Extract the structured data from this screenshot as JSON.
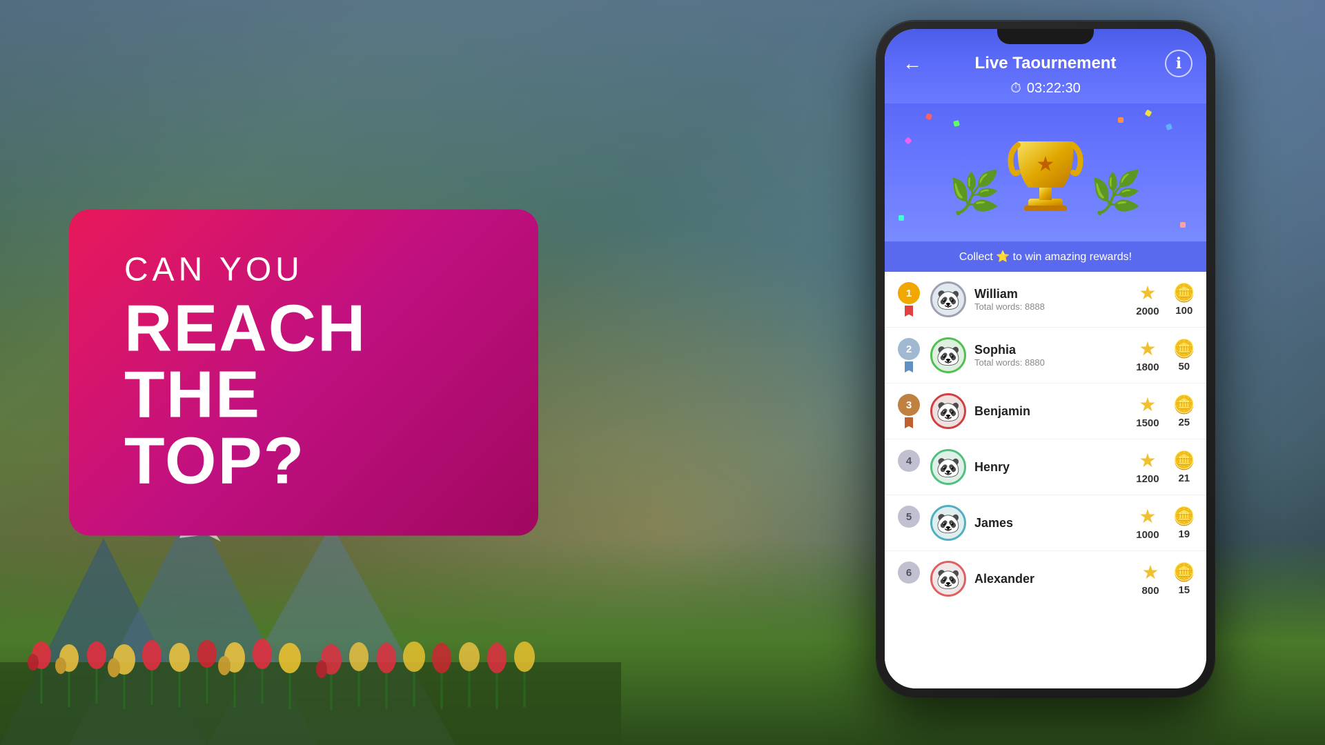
{
  "background": {
    "colors": [
      "#4a7c3f",
      "#6aaa5a",
      "#7ab8c0",
      "#4a6080"
    ]
  },
  "left_panel": {
    "line1": "CAN YOU",
    "line2": "REACH THE",
    "line3": "TOP?"
  },
  "phone": {
    "app": {
      "header": {
        "back_label": "←",
        "title": "Live Taournement",
        "info_label": "ℹ"
      },
      "timer": {
        "icon": "⏱",
        "value": "03:22:30"
      },
      "collect_bar": "Collect ⭐ to win amazing rewards!",
      "leaderboard": [
        {
          "rank": 1,
          "name": "William",
          "words_label": "Total words: 8888",
          "score": 2000,
          "coins": 100,
          "avatar": "🐼",
          "ribbon": true
        },
        {
          "rank": 2,
          "name": "Sophia",
          "words_label": "Total words: 8880",
          "score": 1800,
          "coins": 50,
          "avatar": "🐼",
          "ribbon": true
        },
        {
          "rank": 3,
          "name": "Benjamin",
          "words_label": "",
          "score": 1500,
          "coins": 25,
          "avatar": "🐼",
          "ribbon": true
        },
        {
          "rank": 4,
          "name": "Henry",
          "words_label": "",
          "score": 1200,
          "coins": 21,
          "avatar": "🐼",
          "ribbon": false
        },
        {
          "rank": 5,
          "name": "James",
          "words_label": "",
          "score": 1000,
          "coins": 19,
          "avatar": "🐼",
          "ribbon": false
        },
        {
          "rank": 6,
          "name": "Alexander",
          "words_label": "",
          "score": 800,
          "coins": 15,
          "avatar": "🐼",
          "ribbon": false
        }
      ]
    }
  }
}
